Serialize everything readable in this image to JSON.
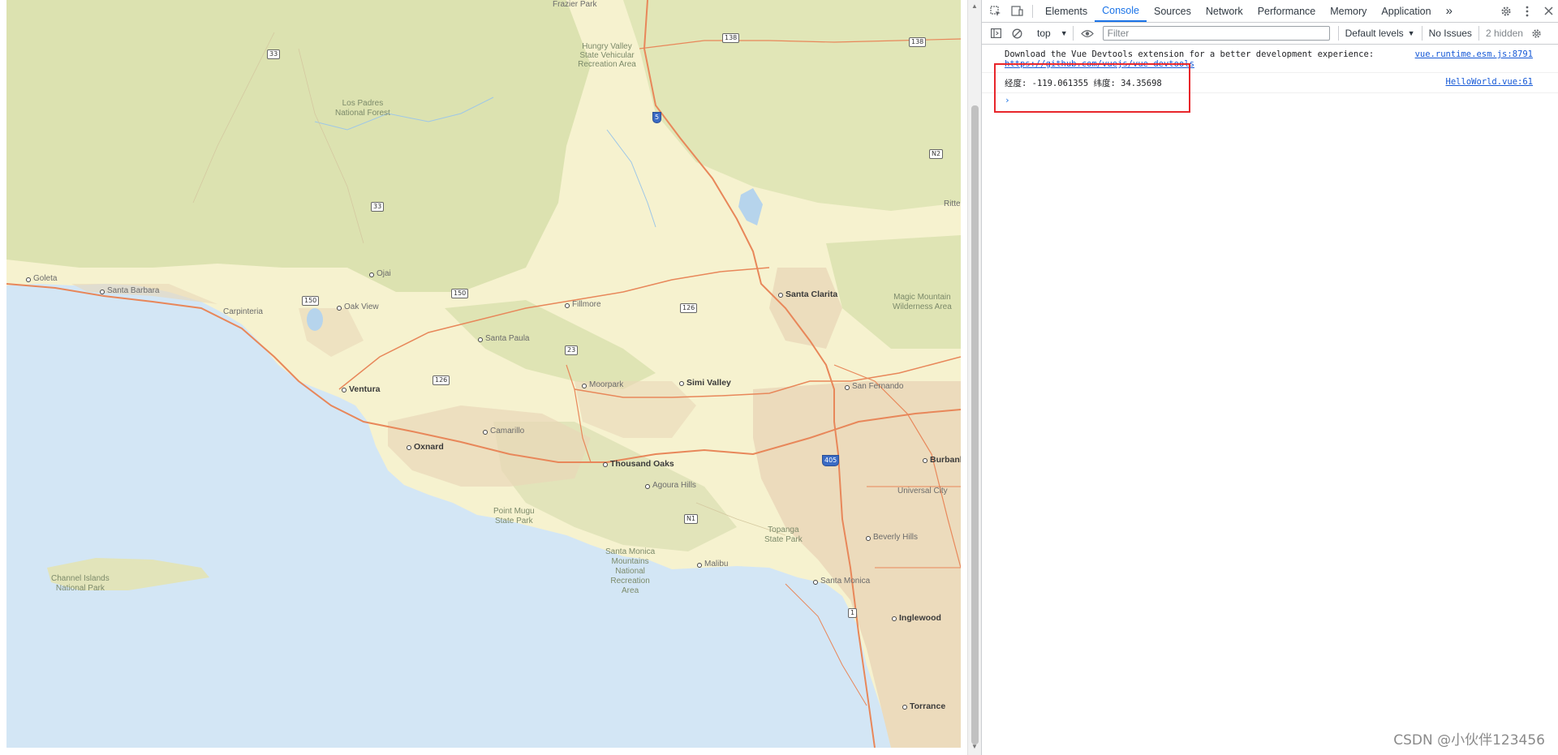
{
  "map": {
    "places": [
      {
        "name": "Frazier Park",
        "kind": "town"
      },
      {
        "name": "Hungry Valley\nState Vehicular\nRecreation Area",
        "kind": "park"
      },
      {
        "name": "Los Padres\nNational Forest",
        "kind": "park"
      },
      {
        "name": "Goleta",
        "kind": "town"
      },
      {
        "name": "Santa Barbara",
        "kind": "town"
      },
      {
        "name": "Carpinteria",
        "kind": "town"
      },
      {
        "name": "Ojai",
        "kind": "town"
      },
      {
        "name": "Oak View",
        "kind": "town"
      },
      {
        "name": "Fillmore",
        "kind": "town"
      },
      {
        "name": "Santa Paula",
        "kind": "town"
      },
      {
        "name": "Santa Clarita",
        "kind": "city"
      },
      {
        "name": "Magic Mountain\nWilderness Area",
        "kind": "park"
      },
      {
        "name": "Ventura",
        "kind": "city"
      },
      {
        "name": "Moorpark",
        "kind": "town"
      },
      {
        "name": "Simi Valley",
        "kind": "city"
      },
      {
        "name": "San Fernando",
        "kind": "town"
      },
      {
        "name": "Camarillo",
        "kind": "town"
      },
      {
        "name": "Oxnard",
        "kind": "city"
      },
      {
        "name": "Thousand Oaks",
        "kind": "city"
      },
      {
        "name": "Burbank",
        "kind": "city"
      },
      {
        "name": "Agoura Hills",
        "kind": "town"
      },
      {
        "name": "Universal City",
        "kind": "town"
      },
      {
        "name": "Point Mugu\nState Park",
        "kind": "park"
      },
      {
        "name": "Topanga\nState Park",
        "kind": "park"
      },
      {
        "name": "Beverly Hills",
        "kind": "town"
      },
      {
        "name": "Santa Monica\nMountains\nNational\nRecreation\nArea",
        "kind": "park"
      },
      {
        "name": "Malibu",
        "kind": "town"
      },
      {
        "name": "Channel Islands\nNational Park",
        "kind": "park"
      },
      {
        "name": "Santa Monica",
        "kind": "town"
      },
      {
        "name": "Inglewood",
        "kind": "city"
      },
      {
        "name": "Torrance",
        "kind": "city"
      },
      {
        "name": "Ritte",
        "kind": "town"
      }
    ],
    "shields": [
      {
        "label": "138",
        "kind": "state"
      },
      {
        "label": "138",
        "kind": "state"
      },
      {
        "label": "33",
        "kind": "state"
      },
      {
        "label": "5",
        "kind": "interstate"
      },
      {
        "label": "N2",
        "kind": "county"
      },
      {
        "label": "33",
        "kind": "state"
      },
      {
        "label": "150",
        "kind": "state"
      },
      {
        "label": "150",
        "kind": "state"
      },
      {
        "label": "126",
        "kind": "state"
      },
      {
        "label": "23",
        "kind": "state"
      },
      {
        "label": "126",
        "kind": "state"
      },
      {
        "label": "405",
        "kind": "interstate"
      },
      {
        "label": "N1",
        "kind": "county"
      },
      {
        "label": "1",
        "kind": "state"
      }
    ]
  },
  "devtools": {
    "tabs": [
      "Elements",
      "Console",
      "Sources",
      "Network",
      "Performance",
      "Memory",
      "Application"
    ],
    "active_tab": "Console",
    "more_tabs": "»",
    "context": "top",
    "filter_placeholder": "Filter",
    "levels": "Default levels",
    "issues": "No Issues",
    "hidden": "2 hidden",
    "messages": [
      {
        "text": "Download the Vue Devtools extension for a better development experience:",
        "link": "https://github.com/vuejs/vue-devtools",
        "source": "vue.runtime.esm.js:8791"
      },
      {
        "text": "经度: -119.061355 纬度: 34.35698",
        "source": "HelloWorld.vue:61"
      }
    ],
    "prompt": "›"
  },
  "watermark": "CSDN @小伙伴123456",
  "colors": {
    "highlight_box": "#e8262b",
    "active_tab": "#1a73e8",
    "ocean": "#d3e6f5",
    "land": "#f6f2cf",
    "forest": "#dfe4b4",
    "urban": "#ead7b8",
    "highway": "#e8875a"
  }
}
